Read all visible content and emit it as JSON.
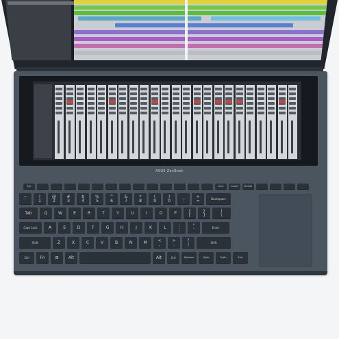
{
  "brand": {
    "label": "ASUS ZenBook"
  },
  "fn_row": [
    "Esc",
    "",
    "",
    "",
    "",
    "",
    "",
    "",
    "",
    "",
    "",
    "",
    "",
    "",
    "Scrn",
    "Insert",
    "Delete",
    "",
    "",
    "",
    ""
  ],
  "rows": {
    "number": [
      {
        "label": "~\n`"
      },
      {
        "label": "!\n1"
      },
      {
        "label": "@\n2"
      },
      {
        "label": "#\n3"
      },
      {
        "label": "$\n4"
      },
      {
        "label": "%\n5"
      },
      {
        "label": "^\n6"
      },
      {
        "label": "&\n7"
      },
      {
        "label": "*\n8"
      },
      {
        "label": "(\n9"
      },
      {
        "label": ")\n0"
      },
      {
        "label": "_\n-"
      },
      {
        "label": "+\n="
      },
      {
        "label": "Backspace"
      }
    ],
    "top": [
      {
        "label": "Tab"
      },
      {
        "label": "Q"
      },
      {
        "label": "W"
      },
      {
        "label": "E"
      },
      {
        "label": "R"
      },
      {
        "label": "T"
      },
      {
        "label": "Y"
      },
      {
        "label": "U"
      },
      {
        "label": "I"
      },
      {
        "label": "O"
      },
      {
        "label": "P"
      },
      {
        "label": "{\n["
      },
      {
        "label": "}\n]"
      },
      {
        "label": "|\n\\"
      }
    ],
    "home": [
      {
        "label": "Caps Lock"
      },
      {
        "label": "A"
      },
      {
        "label": "S"
      },
      {
        "label": "D"
      },
      {
        "label": "F"
      },
      {
        "label": "G"
      },
      {
        "label": "H"
      },
      {
        "label": "J"
      },
      {
        "label": "K"
      },
      {
        "label": "L"
      },
      {
        "label": ":\n;"
      },
      {
        "label": "\"\n'"
      },
      {
        "label": "Enter"
      }
    ],
    "bottom": [
      {
        "label": "Shift"
      },
      {
        "label": "Z"
      },
      {
        "label": "X"
      },
      {
        "label": "C"
      },
      {
        "label": "V"
      },
      {
        "label": "B"
      },
      {
        "label": "N"
      },
      {
        "label": "M"
      },
      {
        "label": "<\n,"
      },
      {
        "label": ">\n."
      },
      {
        "label": "?\n/"
      },
      {
        "label": "Shift"
      }
    ],
    "space": [
      {
        "label": "Ctrl"
      },
      {
        "label": "Fn"
      },
      {
        "label": "⊞"
      },
      {
        "label": "Alt"
      },
      {
        "label": ""
      },
      {
        "label": "Alt"
      },
      {
        "label": "Ctrl"
      },
      {
        "label": "PgHome"
      },
      {
        "label": "PgUp"
      },
      {
        "label": "PgDn"
      },
      {
        "label": "End"
      }
    ]
  },
  "colors": {
    "deck": "#4a5560",
    "key": "#2a3138",
    "key_text": "#c9d0d6",
    "screenpad_bg": "#15191d",
    "main_screen_bg": "#1b1f24"
  },
  "icons": {
    "windows_key": "windows-logo-icon"
  }
}
